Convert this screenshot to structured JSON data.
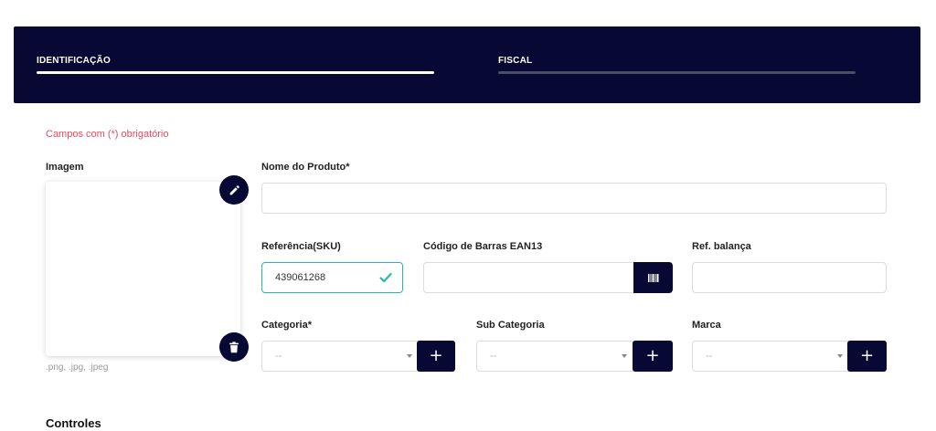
{
  "steps": [
    {
      "label": "IDENTIFICAÇÃO",
      "active": true
    },
    {
      "label": "FISCAL",
      "active": false
    }
  ],
  "required_note": "Campos com (*) obrigatório",
  "image": {
    "label": "Imagem",
    "formats": ".png, .jpg, .jpeg",
    "edit_icon": "pencil-icon",
    "delete_icon": "trash-icon"
  },
  "fields": {
    "product_name": {
      "label": "Nome do Produto*",
      "value": ""
    },
    "sku": {
      "label": "Referência(SKU)",
      "value": "439061268"
    },
    "barcode": {
      "label": "Código de Barras EAN13",
      "value": "",
      "button_icon": "barcode-icon"
    },
    "scale_ref": {
      "label": "Ref. balança",
      "value": ""
    },
    "category": {
      "label": "Categoria*",
      "selected": "--"
    },
    "subcategory": {
      "label": "Sub Categoria",
      "selected": "--"
    },
    "brand": {
      "label": "Marca",
      "selected": "--"
    }
  },
  "add_button": "+",
  "section_controls": "Controles",
  "colors": {
    "navy": "#070833",
    "accent_valid": "#27b9a8",
    "required": "#e84a5f"
  }
}
